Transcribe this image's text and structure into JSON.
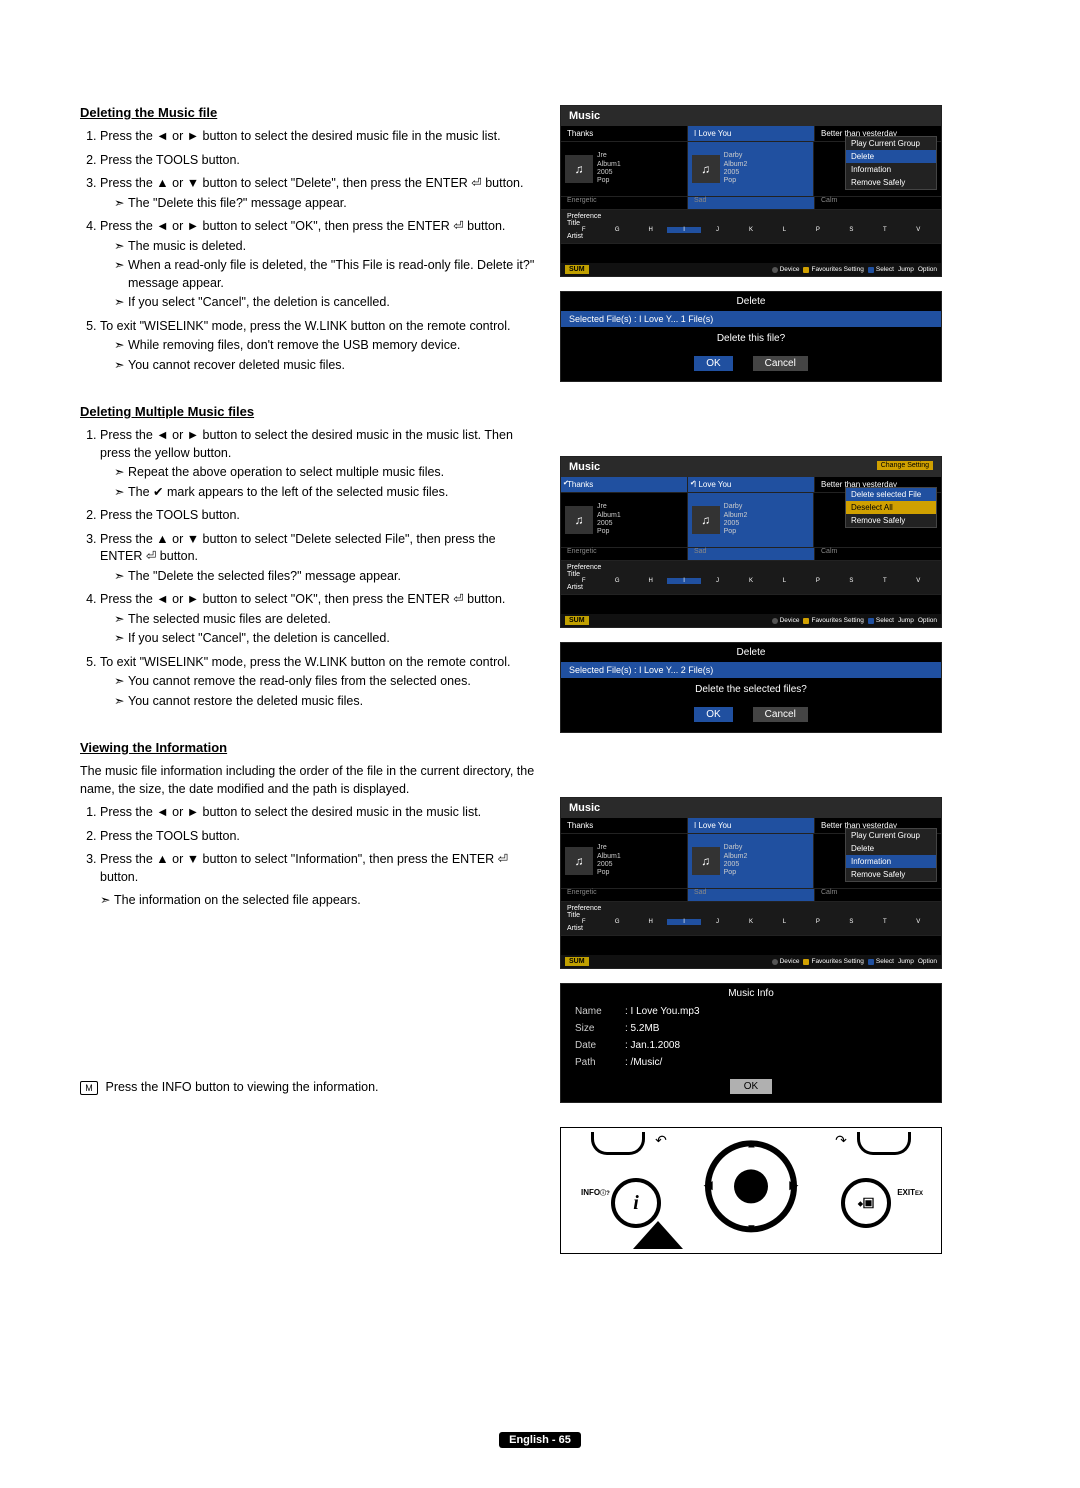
{
  "section1": {
    "title": "Deleting the Music file",
    "step1": "Press the ◄ or ► button to select the desired music file in the music list.",
    "step2": "Press the TOOLS button.",
    "step3": "Press the ▲ or ▼ button to select \"Delete\", then press the ENTER ⏎ button.",
    "note3a": "The \"Delete this file?\" message appear.",
    "step4": "Press the ◄ or ► button to select \"OK\", then press the ENTER ⏎ button.",
    "note4a": "The music is deleted.",
    "note4b": "When a read-only file is deleted, the \"This File is read-only file. Delete it?\" message appear.",
    "note4c": "If you select \"Cancel\", the deletion is cancelled.",
    "step5": "To exit \"WISELINK\" mode, press the W.LINK button on the remote control.",
    "note5a": "While removing files, don't remove the USB memory device.",
    "note5b": "You cannot recover deleted music files."
  },
  "section2": {
    "title": "Deleting Multiple Music files",
    "step1": "Press the ◄ or ► button to select the desired music in the music list. Then press the yellow button.",
    "note1a": "Repeat the above operation to select multiple music files.",
    "note1b": "The ✔ mark appears to the left of the selected music files.",
    "step2": "Press the TOOLS button.",
    "step3": "Press the ▲ or ▼ button to select \"Delete selected File\", then press the ENTER ⏎ button.",
    "note3a": "The \"Delete the selected files?\" message appear.",
    "step4": "Press the ◄ or ► button to select \"OK\", then press the ENTER ⏎ button.",
    "note4a": "The selected music files are deleted.",
    "note4b": "If you select \"Cancel\", the deletion is cancelled.",
    "step5": "To exit \"WISELINK\" mode, press the W.LINK button on the remote control.",
    "note5a": "You cannot remove the read-only files from the selected ones.",
    "note5b": "You cannot restore the deleted music files."
  },
  "section3": {
    "title": "Viewing the Information",
    "intro": "The music file information including the order of the file in the current directory, the name, the size, the date modified and the path is displayed.",
    "step1": "Press the ◄ or ► button to select the desired music in the music list.",
    "step2": "Press the TOOLS button.",
    "step3": "Press the ▲ or ▼ button to select \"Information\", then press the ENTER ⏎ button.",
    "note3a": "The information on the selected file appears.",
    "info_note_icon": "M",
    "info_note": "Press the INFO button to viewing the information."
  },
  "ui": {
    "music_title": "Music",
    "tabs": {
      "t1": "Thanks",
      "t2": "I Love You",
      "t3": "Better than yesterday"
    },
    "thumb1": {
      "artist": "Jre",
      "album": "Album1",
      "year": "2005",
      "genre": "Pop"
    },
    "thumb2": {
      "artist": "Darby",
      "album": "Album2",
      "year": "2005",
      "genre": "Pop"
    },
    "ratings": {
      "r1": "Energetic",
      "r2": "Sad",
      "r3": "Calm"
    },
    "pref": "Preference",
    "title_row": "Title",
    "artist_row": "Artist",
    "sum": "SUM",
    "foot_device": "Device",
    "foot_fav": "Favourites Setting",
    "foot_select": "Select",
    "foot_jump": "Jump",
    "foot_option": "Option",
    "menu1": {
      "m1": "Play Current Group",
      "m2": "Delete",
      "m3": "Information",
      "m4": "Remove Safely"
    },
    "menu2": {
      "m1": "Delete selected File",
      "m2": "Deselect All",
      "m3": "Remove Safely",
      "hdr": "Change Setting"
    },
    "menu3": {
      "m1": "Play Current Group",
      "m2": "Delete",
      "m3": "Information",
      "m4": "Remove Safely"
    },
    "alphas": [
      "F",
      "G",
      "H",
      "I",
      "J",
      "K",
      "L",
      "P",
      "S",
      "T",
      "V"
    ]
  },
  "dialog1": {
    "title": "Delete",
    "sel": "Selected File(s) : I Love Y...   1 File(s)",
    "q": "Delete this file?",
    "ok": "OK",
    "cancel": "Cancel"
  },
  "dialog2": {
    "title": "Delete",
    "sel": "Selected File(s) : I Love Y...   2 File(s)",
    "q": "Delete the selected files?",
    "ok": "OK",
    "cancel": "Cancel"
  },
  "info_dialog": {
    "title": "Music Info",
    "name_k": "Name",
    "name_v": ": I Love You.mp3",
    "size_k": "Size",
    "size_v": ": 5.2MB",
    "date_k": "Date",
    "date_v": ": Jan.1.2008",
    "path_k": "Path",
    "path_v": ": /Music/",
    "ok": "OK"
  },
  "remote": {
    "info": "INFO",
    "exit": "EXIT",
    "info_small": "ⓘ?",
    "exit_small": "EX"
  },
  "footer": "English - 65"
}
